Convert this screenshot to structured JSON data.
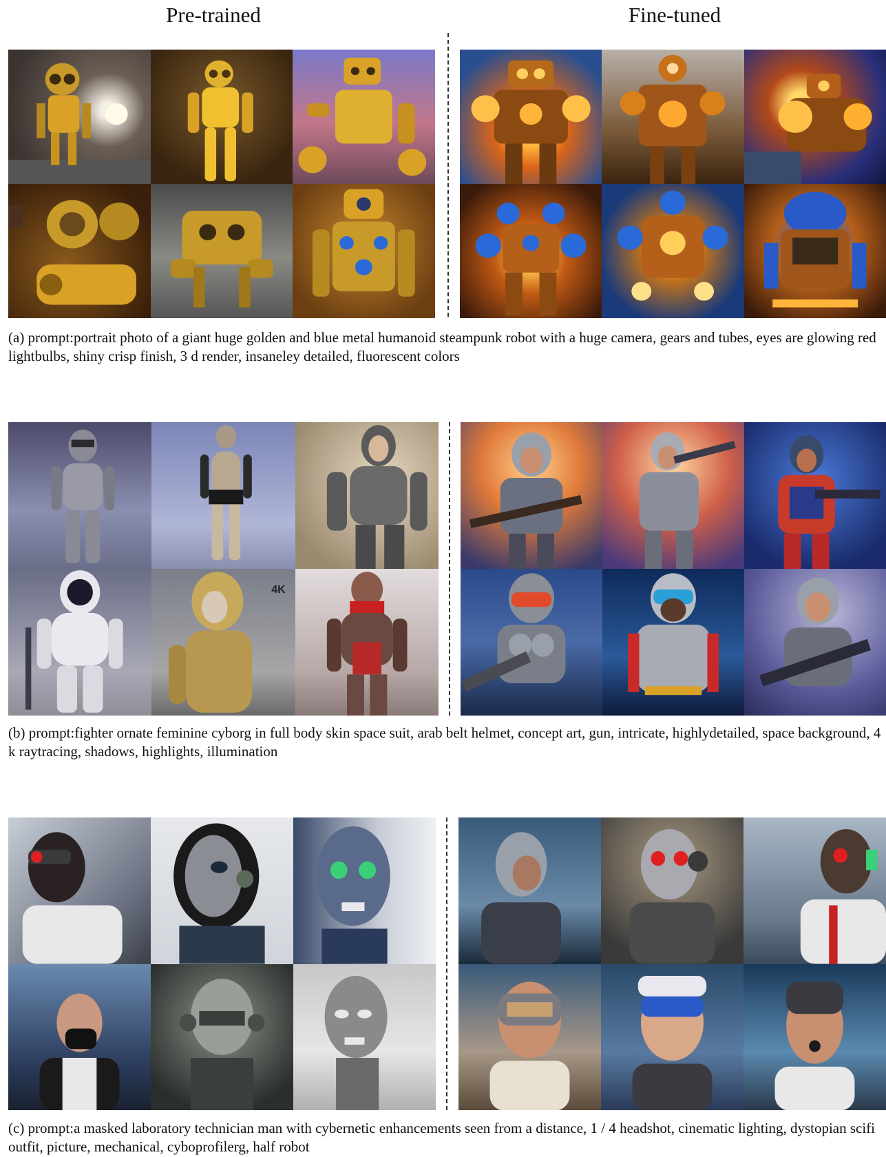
{
  "headers": {
    "pretrained": "Pre-trained",
    "finetuned": "Fine-tuned"
  },
  "sections": [
    {
      "caption": "(a) prompt:portrait photo of a giant huge golden and blue metal humanoid steampunk robot with a huge camera, gears and tubes, eyes are glowing red lightbulbs, shiny crisp finish, 3 d render, insaneley detailed, fluorescent colors"
    },
    {
      "caption": "(b) prompt:fighter ornate feminine cyborg in full body skin space suit, arab belt helmet, concept art, gun, intricate, highlydetailed, space background, 4 k raytracing, shadows, highlights, illumination"
    },
    {
      "caption": "(c) prompt:a masked laboratory technician man with cybernetic enhancements seen from a distance, 1 / 4 headshot, cinematic lighting, dystopian scifi outfit, picture, mechanical, cyboprofilerg, half robot"
    }
  ],
  "tile_labels": {
    "watermark": "4K"
  },
  "colors": {
    "gold": "#d9a227",
    "blue_accent": "#2a6ad8",
    "red_eye": "#e02020",
    "green_eye": "#3ad07a"
  }
}
